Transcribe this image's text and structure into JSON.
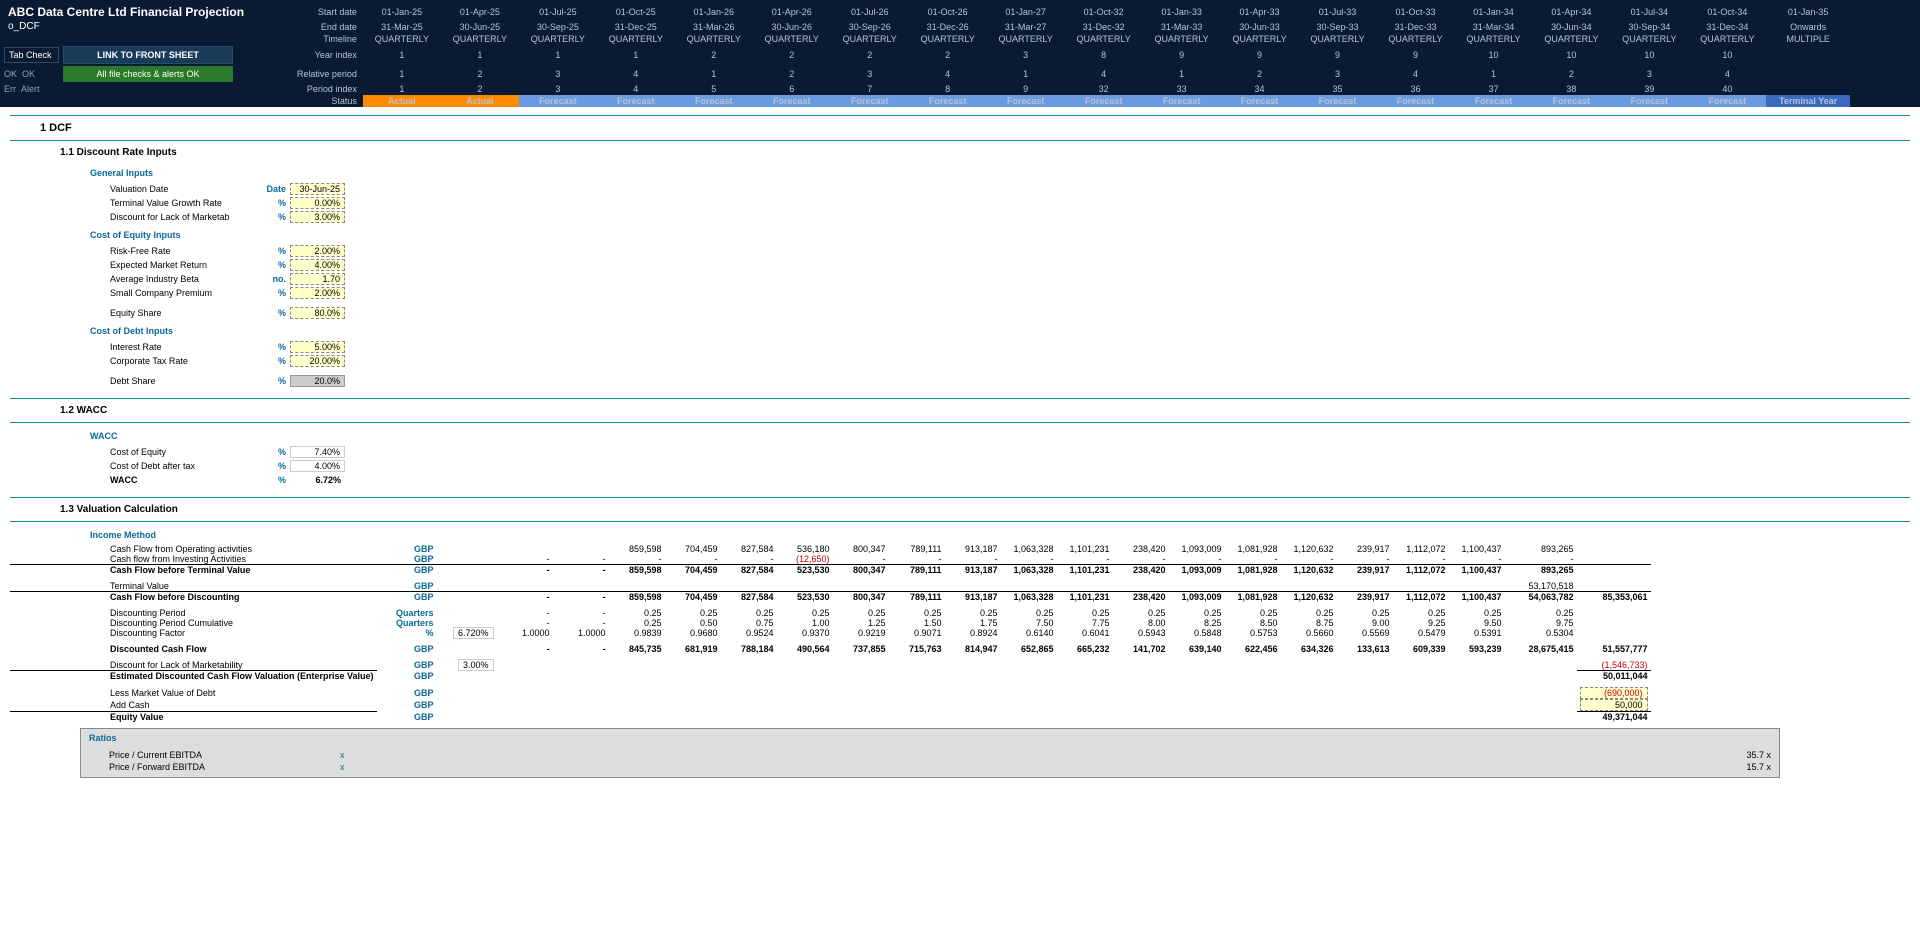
{
  "header": {
    "title": "ABC Data Centre Ltd Financial Projection",
    "sheet": "o_DCF",
    "tab_check_label": "Tab Check",
    "ok1": "OK",
    "ok2": "OK",
    "err": "Err",
    "alert": "Alert",
    "link_btn": "LINK TO FRONT SHEET",
    "alert_btn": "All file checks & alerts OK",
    "labels": [
      "Start date",
      "End date",
      "Timeline",
      "Year index",
      "Relative period",
      "Period index",
      "Status"
    ],
    "start": [
      "01-Jan-25",
      "01-Apr-25",
      "01-Jul-25",
      "01-Oct-25",
      "01-Jan-26",
      "01-Apr-26",
      "01-Jul-26",
      "01-Oct-26",
      "01-Jan-27",
      "01-Oct-32",
      "01-Jan-33",
      "01-Apr-33",
      "01-Jul-33",
      "01-Oct-33",
      "01-Jan-34",
      "01-Apr-34",
      "01-Jul-34",
      "01-Oct-34",
      "01-Jan-35"
    ],
    "end": [
      "31-Mar-25",
      "30-Jun-25",
      "30-Sep-25",
      "31-Dec-25",
      "31-Mar-26",
      "30-Jun-26",
      "30-Sep-26",
      "31-Dec-26",
      "31-Mar-27",
      "31-Dec-32",
      "31-Mar-33",
      "30-Jun-33",
      "30-Sep-33",
      "31-Dec-33",
      "31-Mar-34",
      "30-Jun-34",
      "30-Sep-34",
      "31-Dec-34",
      "Onwards"
    ],
    "timeline": [
      "QUARTERLY",
      "QUARTERLY",
      "QUARTERLY",
      "QUARTERLY",
      "QUARTERLY",
      "QUARTERLY",
      "QUARTERLY",
      "QUARTERLY",
      "QUARTERLY",
      "QUARTERLY",
      "QUARTERLY",
      "QUARTERLY",
      "QUARTERLY",
      "QUARTERLY",
      "QUARTERLY",
      "QUARTERLY",
      "QUARTERLY",
      "QUARTERLY",
      "MULTIPLE"
    ],
    "yidx": [
      "1",
      "1",
      "1",
      "1",
      "2",
      "2",
      "2",
      "2",
      "3",
      "8",
      "9",
      "9",
      "9",
      "9",
      "10",
      "10",
      "10",
      "10",
      ""
    ],
    "relp": [
      "1",
      "2",
      "3",
      "4",
      "1",
      "2",
      "3",
      "4",
      "1",
      "4",
      "1",
      "2",
      "3",
      "4",
      "1",
      "2",
      "3",
      "4",
      ""
    ],
    "pidx": [
      "1",
      "2",
      "3",
      "4",
      "5",
      "6",
      "7",
      "8",
      "9",
      "32",
      "33",
      "34",
      "35",
      "36",
      "37",
      "38",
      "39",
      "40",
      ""
    ],
    "status": [
      "Actual",
      "Actual",
      "Forecast",
      "Forecast",
      "Forecast",
      "Forecast",
      "Forecast",
      "Forecast",
      "Forecast",
      "Forecast",
      "Forecast",
      "Forecast",
      "Forecast",
      "Forecast",
      "Forecast",
      "Forecast",
      "Forecast",
      "Forecast",
      "Terminal Year"
    ]
  },
  "sections": {
    "s1": "1    DCF",
    "s11": "1.1    Discount Rate Inputs",
    "s12": "1.2    WACC",
    "s13": "1.3    Valuation Calculation",
    "general": "General Inputs",
    "coe": "Cost of Equity Inputs",
    "cod": "Cost of Debt Inputs",
    "wacc": "WACC",
    "income": "Income Method",
    "ratios": "Ratios"
  },
  "inputs": {
    "valuation_date_lbl": "Valuation Date",
    "valuation_date_unit": "Date",
    "valuation_date": "30-Jun-25",
    "tvgr_lbl": "Terminal Value Growth Rate",
    "tvgr_unit": "%",
    "tvgr": "0.00%",
    "dlom_lbl": "Discount for Lack of Marketability",
    "dlom_unit": "%",
    "dlom": "3.00%",
    "rfr_lbl": "Risk-Free Rate",
    "rfr_unit": "%",
    "rfr": "2.00%",
    "emr_lbl": "Expected Market Return",
    "emr_unit": "%",
    "emr": "4.00%",
    "beta_lbl": "Average Industry Beta",
    "beta_unit": "no.",
    "beta": "1.70",
    "scp_lbl": "Small Company Premium",
    "scp_unit": "%",
    "scp": "2.00%",
    "eqs_lbl": "Equity Share",
    "eqs_unit": "%",
    "eqs": "80.0%",
    "ir_lbl": "Interest Rate",
    "ir_unit": "%",
    "ir": "5.00%",
    "ctr_lbl": "Corporate Tax Rate",
    "ctr_unit": "%",
    "ctr": "20.00%",
    "ds_lbl": "Debt Share",
    "ds_unit": "%",
    "ds": "20.0%"
  },
  "wacc": {
    "coe_lbl": "Cost of Equity",
    "coe_unit": "%",
    "coe": "7.40%",
    "codat_lbl": "Cost of Debt after tax",
    "codat_unit": "%",
    "codat": "4.00%",
    "wacc_lbl": "WACC",
    "wacc_unit": "%",
    "wacc": "6.72%"
  },
  "valuation": {
    "wacc_input": "6.720%",
    "dlom_input": "3.00%",
    "cfo_lbl": "Cash Flow from Operating activities",
    "gbp": "GBP",
    "cfi_lbl": "Cash flow from Investing Activities",
    "cftv_lbl": "Cash Flow before Terminal Value",
    "tv_lbl": "Terminal Value",
    "tv": "53,170,518",
    "cfbd_lbl": "Cash Flow before Discounting",
    "dp_lbl": "Discounting Period",
    "q": "Quarters",
    "dpc_lbl": "Discounting Period Cumulative",
    "df_lbl": "Discounting Factor",
    "pct": "%",
    "dcf_lbl": "Discounted Cash Flow",
    "dlom2_lbl": "Discount for Lack of Marketability",
    "est_lbl": "Estimated Discounted Cash Flow Valuation (Enterprise Value)",
    "lmvd_lbl": "Less Market Value of Debt",
    "addcash_lbl": "Add Cash",
    "eq_lbl": "Equity Value",
    "cfo": [
      "",
      "",
      "859,598",
      "704,459",
      "827,584",
      "536,180",
      "800,347",
      "789,111",
      "913,187",
      "1,063,328",
      "1,101,231",
      "238,420",
      "1,093,009",
      "1,081,928",
      "1,120,632",
      "239,917",
      "1,112,072",
      "1,100,437",
      "893,265"
    ],
    "cfi": [
      "-",
      "-",
      "-",
      "-",
      "-",
      "(12,650)",
      "-",
      "-",
      "-",
      "-",
      "-",
      "-",
      "-",
      "-",
      "-",
      "-",
      "-",
      "-",
      "-"
    ],
    "cftv": [
      "-",
      "-",
      "859,598",
      "704,459",
      "827,584",
      "523,530",
      "800,347",
      "789,111",
      "913,187",
      "1,063,328",
      "1,101,231",
      "238,420",
      "1,093,009",
      "1,081,928",
      "1,120,632",
      "239,917",
      "1,112,072",
      "1,100,437",
      "893,265"
    ],
    "cfbd": [
      "-",
      "-",
      "859,598",
      "704,459",
      "827,584",
      "523,530",
      "800,347",
      "789,111",
      "913,187",
      "1,063,328",
      "1,101,231",
      "238,420",
      "1,093,009",
      "1,081,928",
      "1,120,632",
      "239,917",
      "1,112,072",
      "1,100,437",
      "54,063,782"
    ],
    "cfbd_total": "85,353,061",
    "dp": [
      "-",
      "-",
      "0.25",
      "0.25",
      "0.25",
      "0.25",
      "0.25",
      "0.25",
      "0.25",
      "0.25",
      "0.25",
      "0.25",
      "0.25",
      "0.25",
      "0.25",
      "0.25",
      "0.25",
      "0.25",
      "0.25"
    ],
    "dpc": [
      "-",
      "-",
      "0.25",
      "0.50",
      "0.75",
      "1.00",
      "1.25",
      "1.50",
      "1.75",
      "7.50",
      "7.75",
      "8.00",
      "8.25",
      "8.50",
      "8.75",
      "9.00",
      "9.25",
      "9.50",
      "9.75"
    ],
    "df": [
      "1.0000",
      "1.0000",
      "0.9839",
      "0.9680",
      "0.9524",
      "0.9370",
      "0.9219",
      "0.9071",
      "0.8924",
      "0.6140",
      "0.6041",
      "0.5943",
      "0.5848",
      "0.5753",
      "0.5660",
      "0.5569",
      "0.5479",
      "0.5391",
      "0.5304"
    ],
    "dcf": [
      "-",
      "-",
      "845,735",
      "681,919",
      "788,184",
      "490,564",
      "737,855",
      "715,763",
      "814,947",
      "652,865",
      "665,232",
      "141,702",
      "639,140",
      "622,456",
      "634,326",
      "133,613",
      "609,339",
      "593,239",
      "28,675,415"
    ],
    "dcf_total": "51,557,777",
    "dlom_total": "(1,546,733)",
    "ev_total": "50,011,044",
    "lmvd": "(690,000)",
    "addcash": "50,000",
    "eq": "49,371,044"
  },
  "ratios": {
    "pce_lbl": "Price / Current EBITDA",
    "pce_unit": "x",
    "pce": "35.7 x",
    "pfe_lbl": "Price / Forward EBITDA",
    "pfe_unit": "x",
    "pfe": "15.7 x"
  }
}
